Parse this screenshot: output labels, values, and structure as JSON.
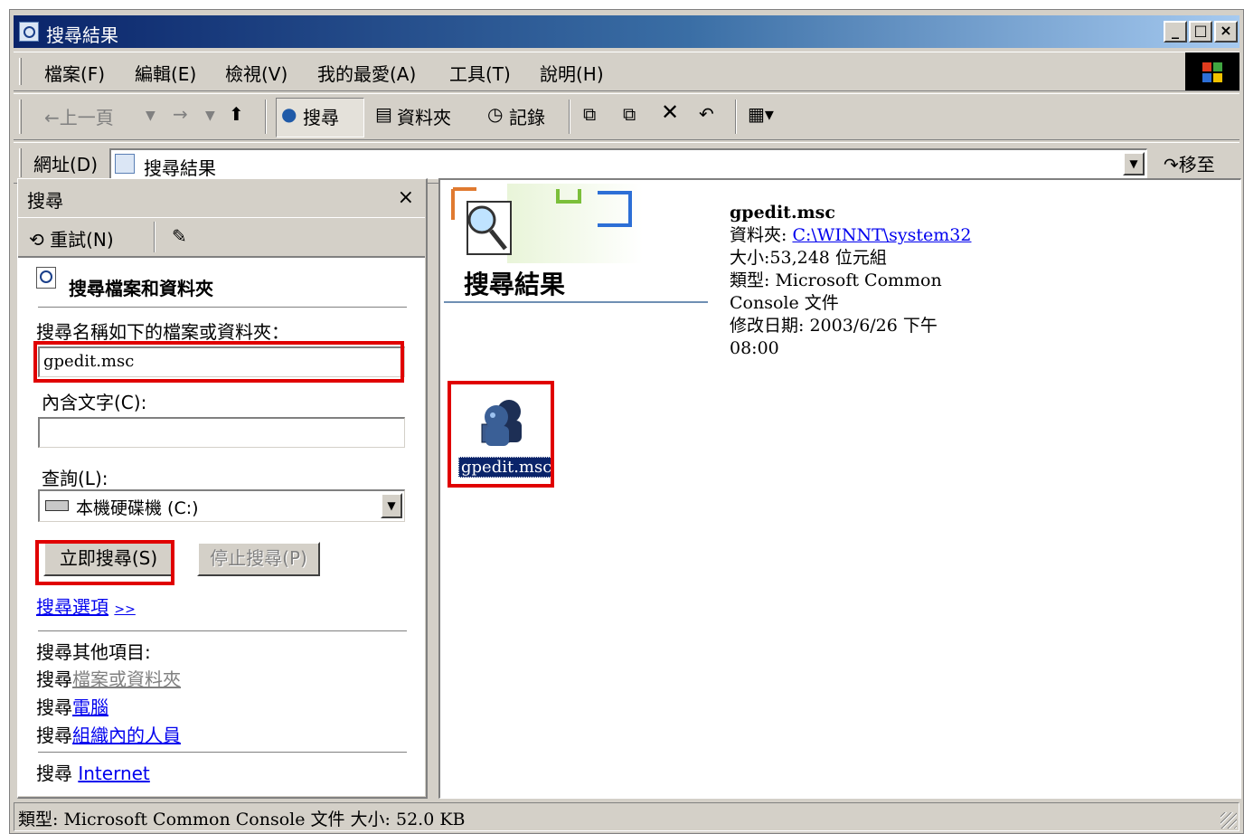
{
  "window": {
    "title": "搜尋結果",
    "controls": [
      "_",
      "□",
      "×"
    ]
  },
  "menu": [
    "檔案(F)",
    "編輯(E)",
    "檢視(V)",
    "我的最愛(A)",
    "工具(T)",
    "說明(H)"
  ],
  "toolbar": {
    "back": "←上一頁",
    "forward": "→",
    "search": "搜尋",
    "folders": "資料夾",
    "history": "記錄"
  },
  "address": {
    "label": "網址(D)",
    "value": "搜尋結果",
    "go": "移至"
  },
  "search_pane": {
    "title": "搜尋",
    "close": "×",
    "retry": "重試(N)",
    "section_title": "搜尋檔案和資料夾",
    "name_label": "搜尋名稱如下的檔案或資料夾：",
    "name_value": "gpedit.msc",
    "containing_label": "內含文字(C):",
    "containing_value": "",
    "look_in_label": "查詢(L):",
    "look_in_value": "本機硬碟機 (C:)",
    "search_now": "立即搜尋(S)",
    "stop_search": "停止搜尋(P)",
    "options_link": "搜尋選項",
    "options_arrow": ">>",
    "other_title": "搜尋其他項目:",
    "other_items": [
      {
        "prefix": "搜尋",
        "link": "檔案或資料夾",
        "style": "gray"
      },
      {
        "prefix": "搜尋",
        "link": "電腦",
        "style": "blue"
      },
      {
        "prefix": "搜尋",
        "link": "組織內的人員",
        "style": "blue"
      }
    ],
    "internet_prefix": "搜尋",
    "internet_link": "Internet"
  },
  "results": {
    "title": "搜尋結果",
    "info_name": "gpedit.msc",
    "info_folder_label": "資料夾:",
    "info_folder_link": "C:\\WINNT\\system32",
    "info_size": "大小:53,248 位元組",
    "info_type_1": "類型: Microsoft Common",
    "info_type_2": "Console 文件",
    "info_modified_1": "修改日期: 2003/6/26 下午",
    "info_modified_2": "08:00",
    "file_label": "gpedit.msc"
  },
  "status": {
    "text": "類型: Microsoft Common Console 文件 大小: 52.0 KB"
  },
  "colors": {
    "highlight": "#e00000",
    "titlebar": "#0a246a",
    "link": "#0000ee"
  }
}
